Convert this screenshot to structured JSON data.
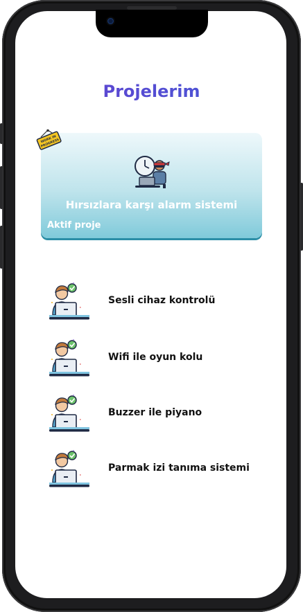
{
  "page": {
    "title": "Projelerim"
  },
  "active_project": {
    "title": "Hırsızlara karşı alarm sistemi",
    "status": "Aktif proje",
    "badge_icon": "work-in-progress-sign-icon",
    "illustration_icon": "thief-with-laptop-icon"
  },
  "projects": [
    {
      "label": "Sesli cihaz kontrolü",
      "icon": "developer-avatar-icon"
    },
    {
      "label": "Wifi ile oyun kolu",
      "icon": "developer-avatar-icon"
    },
    {
      "label": "Buzzer ile piyano",
      "icon": "developer-avatar-icon"
    },
    {
      "label": "Parmak izi tanıma sistemi",
      "icon": "developer-avatar-icon"
    }
  ],
  "colors": {
    "title_gradient_start": "#6a3fd0",
    "title_gradient_end": "#3f5bd6",
    "card_top": "#eef8fb",
    "card_bottom": "#80cada"
  }
}
